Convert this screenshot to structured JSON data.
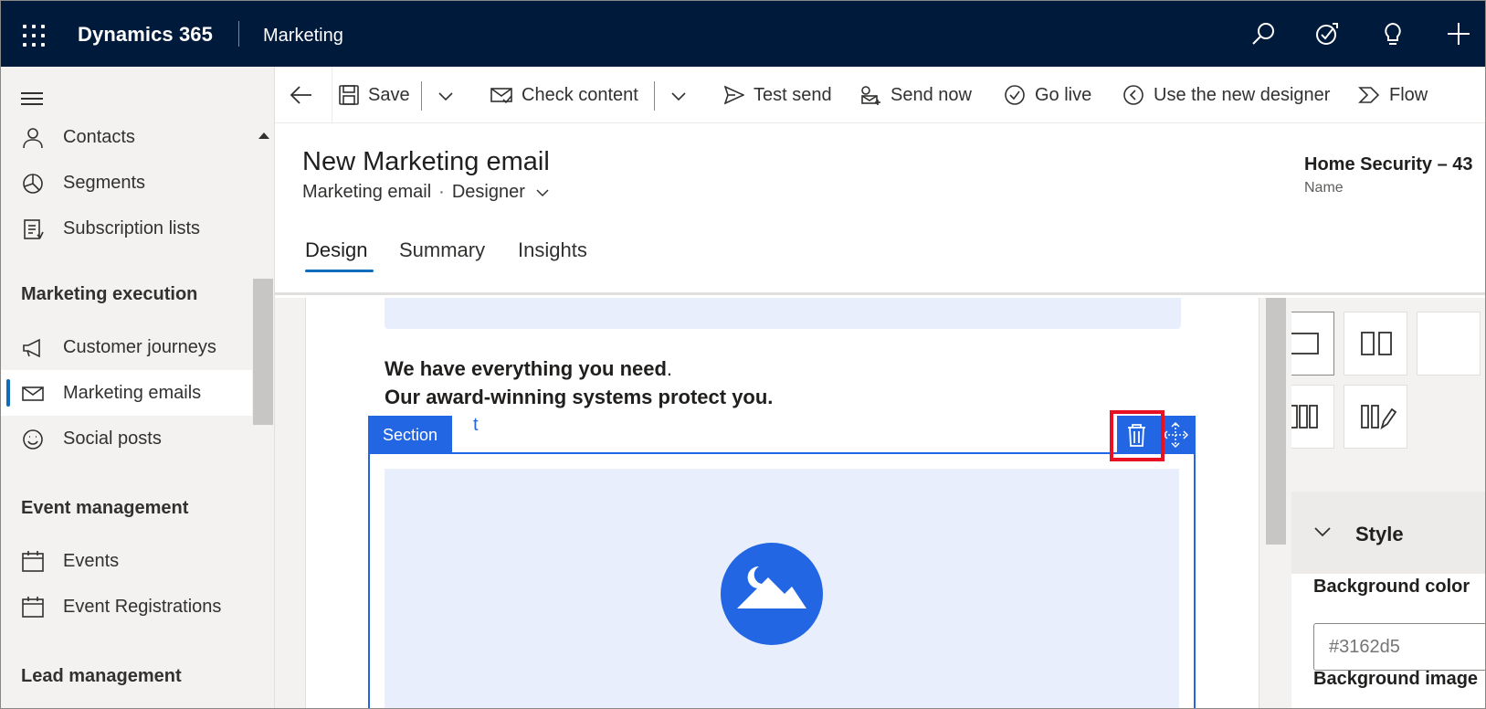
{
  "topbar": {
    "brand": "Dynamics 365",
    "app": "Marketing",
    "icons": [
      "search-icon",
      "assistant-icon",
      "lightbulb-icon",
      "plus-icon"
    ]
  },
  "sidebar": {
    "items": [
      {
        "label": "Contacts",
        "icon": "person-icon"
      },
      {
        "label": "Segments",
        "icon": "segments-icon"
      },
      {
        "label": "Subscription lists",
        "icon": "list-icon"
      }
    ],
    "sections": [
      {
        "title": "Marketing execution",
        "items": [
          {
            "label": "Customer journeys",
            "icon": "megaphone-icon"
          },
          {
            "label": "Marketing emails",
            "icon": "mail-icon",
            "selected": true
          },
          {
            "label": "Social posts",
            "icon": "emoji-icon"
          }
        ]
      },
      {
        "title": "Event management",
        "items": [
          {
            "label": "Events",
            "icon": "calendar-icon"
          },
          {
            "label": "Event Registrations",
            "icon": "calendar-icon"
          }
        ]
      },
      {
        "title": "Lead management",
        "items": []
      }
    ]
  },
  "commandbar": {
    "save": "Save",
    "check_content": "Check content",
    "test_send": "Test send",
    "send_now": "Send now",
    "go_live": "Go live",
    "new_designer": "Use the new designer",
    "flow": "Flow"
  },
  "header": {
    "title": "New Marketing email",
    "entity": "Marketing email",
    "separator": "·",
    "form": "Designer",
    "field_value": "Home Security – 43",
    "field_label": "Name",
    "tabs": [
      {
        "label": "Design",
        "active": true
      },
      {
        "label": "Summary",
        "active": false
      },
      {
        "label": "Insights",
        "active": false
      }
    ]
  },
  "canvas": {
    "headline_line1": "We have everything you need",
    "headline_line1_end": ".",
    "headline_line2": "Our award-winning systems protect you.",
    "ghost_char": "t",
    "section_tag": "Section"
  },
  "rightpane": {
    "style_label": "Style",
    "background_color_label": "Background color",
    "background_color_value": "#3162d5",
    "background_image_label": "Background image"
  },
  "colors": {
    "topbar": "#001a3b",
    "accent": "#2266e3",
    "highlight": "#e81123",
    "placeholder": "#e8eefc"
  }
}
